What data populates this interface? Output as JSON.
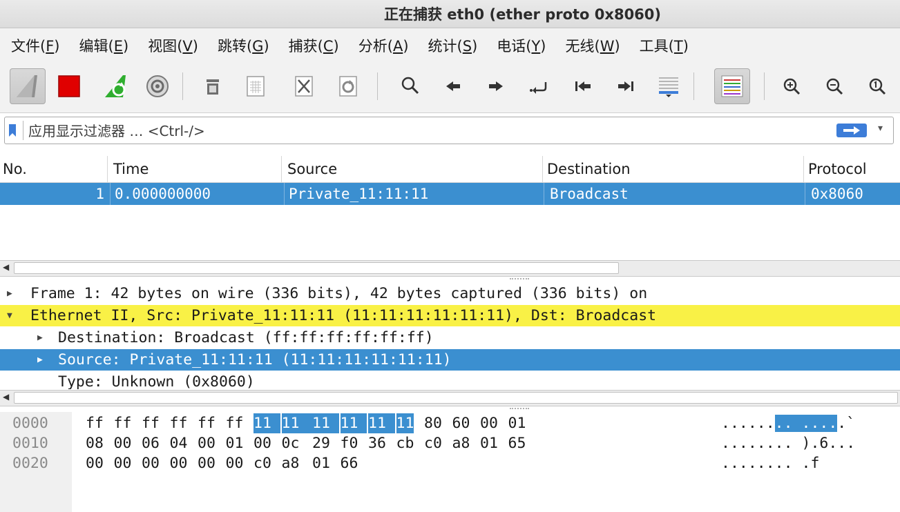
{
  "window": {
    "title": "正在捕获 eth0 (ether proto 0x8060)"
  },
  "menu": [
    {
      "label": "文件",
      "mnemonic": "F"
    },
    {
      "label": "编辑",
      "mnemonic": "E"
    },
    {
      "label": "视图",
      "mnemonic": "V"
    },
    {
      "label": "跳转",
      "mnemonic": "G"
    },
    {
      "label": "捕获",
      "mnemonic": "C"
    },
    {
      "label": "分析",
      "mnemonic": "A"
    },
    {
      "label": "统计",
      "mnemonic": "S"
    },
    {
      "label": "电话",
      "mnemonic": "Y"
    },
    {
      "label": "无线",
      "mnemonic": "W"
    },
    {
      "label": "工具",
      "mnemonic": "T"
    }
  ],
  "toolbar": {
    "icons": [
      "shark-fin-icon",
      "stop-capture-icon",
      "restart-capture-icon",
      "capture-options-icon",
      "open-file-icon",
      "save-file-icon",
      "close-file-icon",
      "reload-file-icon",
      "find-packet-icon",
      "go-back-icon",
      "go-forward-icon",
      "go-to-packet-icon",
      "first-packet-icon",
      "last-packet-icon",
      "auto-scroll-icon",
      "colorize-icon",
      "zoom-in-icon",
      "zoom-out-icon",
      "zoom-normal-icon"
    ],
    "colors": {
      "stop": "#e00000",
      "restart": "#2fae2f",
      "colorize_lines": [
        "#cc3333",
        "#33aa33",
        "#3366cc",
        "#cc9900",
        "#9933cc"
      ]
    }
  },
  "filter": {
    "placeholder": "应用显示过滤器 … <Ctrl-/>",
    "bookmark_color": "#3d7dd8",
    "apply_color": "#3d7dd8"
  },
  "packet_list": {
    "columns": [
      "No.",
      "Time",
      "Source",
      "Destination",
      "Protocol"
    ],
    "rows": [
      {
        "no": "1",
        "time": "0.000000000",
        "source": "Private_11:11:11",
        "destination": "Broadcast",
        "protocol": "0x8060"
      }
    ],
    "selected_color": "#3b8fd0"
  },
  "details": {
    "lines": [
      {
        "expanded": false,
        "text": "Frame 1: 42 bytes on wire (336 bits), 42 bytes captured (336 bits) on"
      },
      {
        "expanded": true,
        "text": "Ethernet II, Src: Private_11:11:11 (11:11:11:11:11:11), Dst: Broadcast"
      },
      {
        "expanded": false,
        "text": "Destination: Broadcast (ff:ff:ff:ff:ff:ff)"
      },
      {
        "expanded": false,
        "text": "Source: Private_11:11:11 (11:11:11:11:11:11)"
      },
      {
        "text": "Type: Unknown (0x8060)"
      }
    ],
    "highlight_yellow": "#f9f146"
  },
  "hex": {
    "rows": [
      {
        "offset": "0000",
        "bytes": [
          "ff",
          "ff",
          "ff",
          "ff",
          "ff",
          "ff",
          "11",
          "11",
          "11",
          "11",
          "11",
          "11",
          "80",
          "60",
          "00",
          "01"
        ],
        "ascii_pre": "......",
        "ascii_sel": ".. ....",
        "ascii_post": ".`"
      },
      {
        "offset": "0010",
        "bytes": [
          "08",
          "00",
          "06",
          "04",
          "00",
          "01",
          "00",
          "0c",
          "29",
          "f0",
          "36",
          "cb",
          "c0",
          "a8",
          "01",
          "65"
        ],
        "ascii_pre": "........ ).6...",
        "ascii_sel": "",
        "ascii_post": ""
      },
      {
        "offset": "0020",
        "bytes": [
          "00",
          "00",
          "00",
          "00",
          "00",
          "00",
          "c0",
          "a8",
          "01",
          "66"
        ],
        "ascii_pre": "........ .f",
        "ascii_sel": "",
        "ascii_post": ""
      }
    ],
    "selected_range": [
      6,
      11
    ]
  }
}
